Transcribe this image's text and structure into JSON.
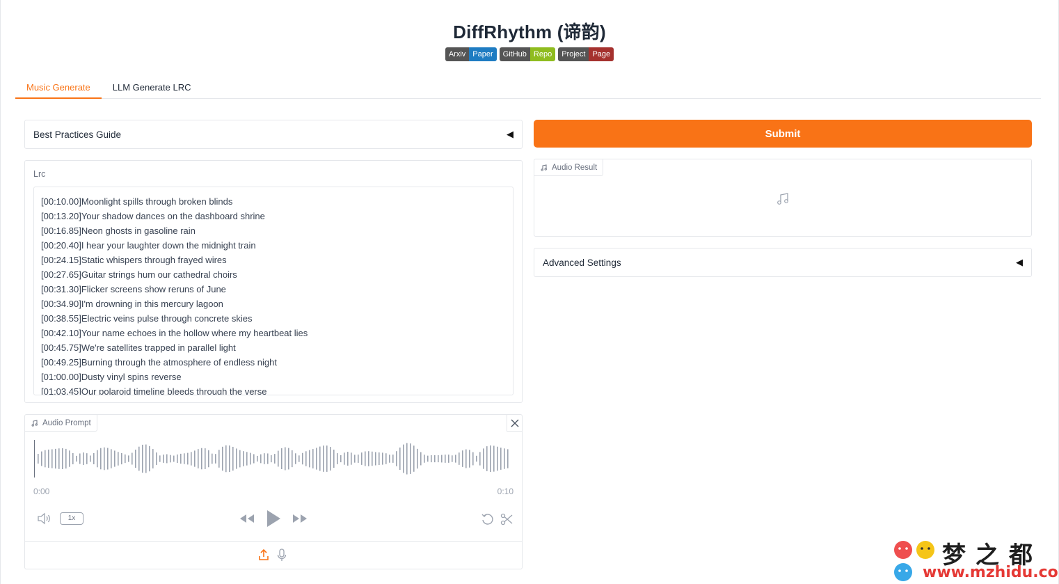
{
  "app": {
    "title": "DiffRhythm (谛韵)",
    "badges": [
      {
        "left": "Arxiv",
        "right": "Paper",
        "color": "#1e7cc2"
      },
      {
        "left": "GitHub",
        "right": "Repo",
        "color": "#8fbc1f"
      },
      {
        "left": "Project",
        "right": "Page",
        "color": "#a5312e"
      }
    ]
  },
  "tabs": [
    {
      "label": "Music Generate",
      "active": true
    },
    {
      "label": "LLM Generate LRC",
      "active": false
    }
  ],
  "left": {
    "guide_label": "Best Practices Guide",
    "lrc_label": "Lrc",
    "lrc_lines": [
      "[00:10.00]Moonlight spills through broken blinds",
      "[00:13.20]Your shadow dances on the dashboard shrine",
      "[00:16.85]Neon ghosts in gasoline rain",
      "[00:20.40]I hear your laughter down the midnight train",
      "[00:24.15]Static whispers through frayed wires",
      "[00:27.65]Guitar strings hum our cathedral choirs",
      "[00:31.30]Flicker screens show reruns of June",
      "[00:34.90]I'm drowning in this mercury lagoon",
      "[00:38.55]Electric veins pulse through concrete skies",
      "[00:42.10]Your name echoes in the hollow where my heartbeat lies",
      "[00:45.75]We're satellites trapped in parallel light",
      "[00:49.25]Burning through the atmosphere of endless night",
      "[01:00.00]Dusty vinyl spins reverse",
      "[01:03.45]Our polaroid timeline bleeds through the verse"
    ],
    "audio_prompt": {
      "label": "Audio Prompt",
      "time_start": "0:00",
      "time_end": "0:10",
      "speed": "1x"
    }
  },
  "right": {
    "submit_label": "Submit",
    "audio_result_label": "Audio Result",
    "advanced_label": "Advanced Settings"
  },
  "watermark": {
    "text": "梦之都",
    "url": "www.mzhidu.com"
  },
  "colors": {
    "accent": "#f97316",
    "border": "#e5e7eb"
  }
}
